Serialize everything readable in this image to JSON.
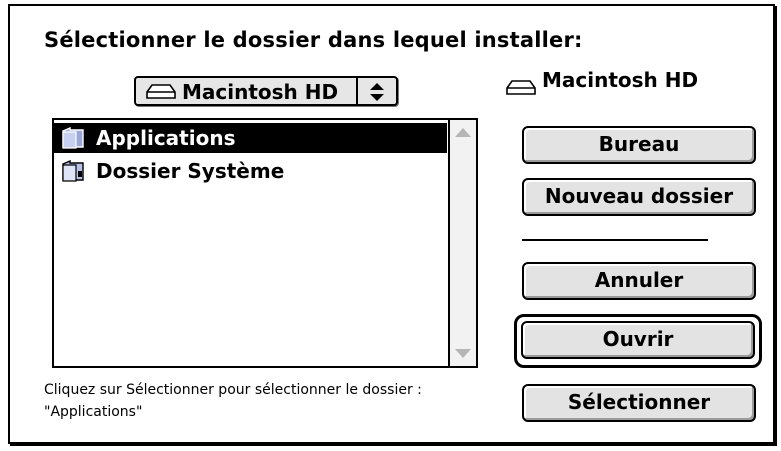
{
  "dialog": {
    "title": "Sélectionner le dossier dans lequel installer:"
  },
  "popup": {
    "icon": "hard-disk-icon",
    "selected": "Macintosh HD"
  },
  "volume": {
    "icon": "hard-disk-icon",
    "label": "Macintosh HD"
  },
  "file_list": {
    "items": [
      {
        "label": "Applications",
        "icon": "folder-icon",
        "selected": true
      },
      {
        "label": "Dossier Système",
        "icon": "system-folder-icon",
        "selected": false
      }
    ]
  },
  "hint": "Cliquez sur Sélectionner pour sélectionner le dossier  : \"Applications\"",
  "buttons": {
    "bureau": "Bureau",
    "nouveau_dossier": "Nouveau dossier",
    "annuler": "Annuler",
    "ouvrir": "Ouvrir",
    "selectionner": "Sélectionner"
  },
  "colors": {
    "selection": "#000000",
    "button_face": "#e3e3e3"
  }
}
